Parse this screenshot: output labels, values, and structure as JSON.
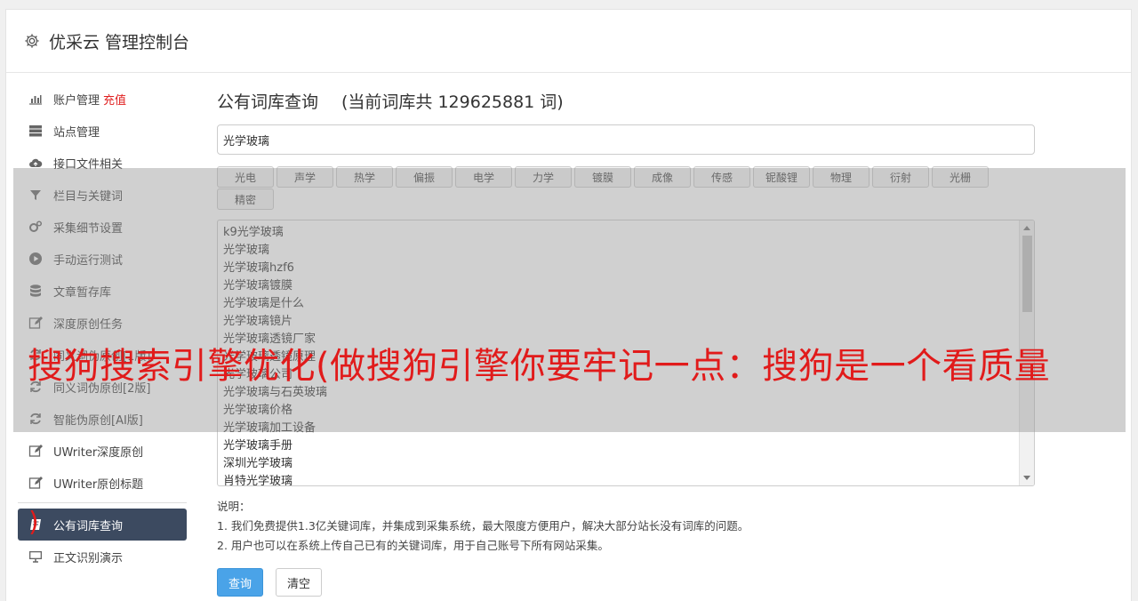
{
  "header": {
    "title": "优采云 管理控制台",
    "icon": "gear-icon"
  },
  "sidebar": {
    "items": [
      {
        "label": "账户管理",
        "badge": "充值",
        "icon": "bar-chart-icon"
      },
      {
        "label": "站点管理",
        "icon": "server-icon"
      },
      {
        "label": "接口文件相关",
        "icon": "cloud-upload-icon"
      },
      {
        "label": "栏目与关键词",
        "icon": "filter-icon"
      },
      {
        "label": "采集细节设置",
        "icon": "gears-icon"
      },
      {
        "label": "手动运行测试",
        "icon": "play-circle-icon"
      },
      {
        "label": "文章暂存库",
        "icon": "database-icon"
      },
      {
        "label": "深度原创任务",
        "icon": "edit-icon"
      },
      {
        "label": "同义词伪原创[1版]",
        "icon": "refresh-icon"
      },
      {
        "label": "同义词伪原创[2版]",
        "icon": "refresh-icon"
      },
      {
        "label": "智能伪原创[AI版]",
        "icon": "refresh-icon"
      },
      {
        "label": "UWriter深度原创",
        "icon": "edit-icon"
      },
      {
        "label": "UWriter原创标题",
        "icon": "edit-icon"
      },
      {
        "label": "公有词库查询",
        "icon": "book-icon"
      },
      {
        "label": "正文识别演示",
        "icon": "monitor-icon"
      }
    ]
  },
  "main": {
    "title": "公有词库查询",
    "count_text": "(当前词库共 129625881 词)",
    "search_value": "光学玻璃",
    "tags": [
      "光电",
      "声学",
      "热学",
      "偏振",
      "电学",
      "力学",
      "镀膜",
      "成像",
      "传感",
      "铌酸锂",
      "物理",
      "衍射",
      "光栅",
      "精密"
    ],
    "results": [
      "k9光学玻璃",
      "光学玻璃",
      "光学玻璃hzf6",
      "光学玻璃镀膜",
      "光学玻璃是什么",
      "光学玻璃镜片",
      "光学玻璃透镜厂家",
      "光学玻璃透镜原理",
      "光学玻璃公司",
      "光学玻璃与石英玻璃",
      "光学玻璃价格",
      "光学玻璃加工设备",
      "光学玻璃手册",
      "深圳光学玻璃",
      "肖特光学玻璃"
    ],
    "notes_title": "说明：",
    "notes": [
      "1. 我们免费提供1.3亿关键词库，并集成到采集系统，最大限度方便用户，解决大部分站长没有词库的问题。",
      "2. 用户也可以在系统上传自己已有的关键词库，用于自己账号下所有网站采集。"
    ],
    "query_button": "查询",
    "clear_button": "清空"
  },
  "overlay": {
    "headline": "搜狗搜索引擎优化(做搜狗引擎你要牢记一点：搜狗是一个看质量",
    "tail": ")"
  },
  "colors": {
    "active_nav": "#3c4a60",
    "primary": "#4aa3e8",
    "headline": "#e11b1b",
    "badge": "#e02020"
  }
}
